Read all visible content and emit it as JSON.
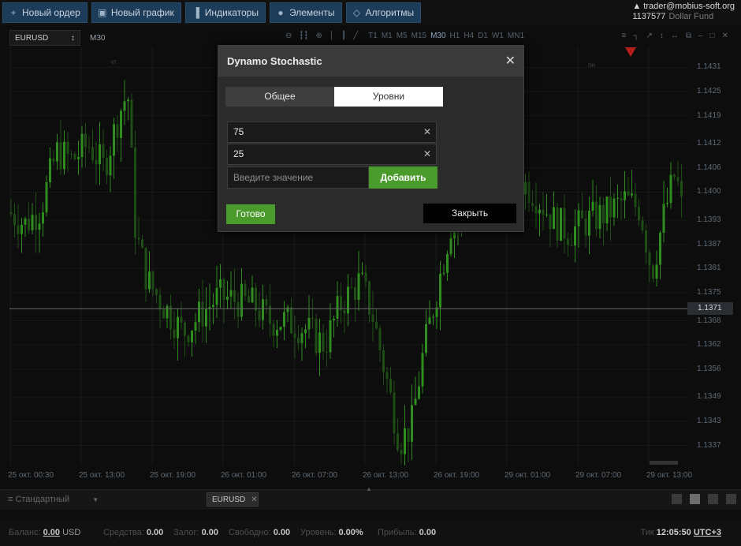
{
  "toolbar": {
    "new_order": "Новый ордер",
    "new_chart": "Новый график",
    "indicators": "Индикаторы",
    "elements": "Элементы",
    "algorithms": "Алгоритмы"
  },
  "account": {
    "email": "trader@mobius-soft.org",
    "number": "1137577",
    "fund": "Dollar Fund"
  },
  "chart_toolbar": {
    "symbol": "EURUSD",
    "timeframe": "M30",
    "timeframes": [
      "T1",
      "M1",
      "M5",
      "M15",
      "M30",
      "H1",
      "H4",
      "D1",
      "W1",
      "MN1"
    ],
    "active_timeframe": "M30"
  },
  "chart_data": {
    "type": "candlestick",
    "y_ticks": [
      "1.1431",
      "1.1425",
      "1.1419",
      "1.1412",
      "1.1406",
      "1.1400",
      "1.1393",
      "1.1387",
      "1.1381",
      "1.1375",
      "1.1368",
      "1.1362",
      "1.1356",
      "1.1349",
      "1.1343",
      "1.1337"
    ],
    "ylim": [
      1.1332,
      1.1436
    ],
    "current_price": "1.1371",
    "current_price_value": 1.1371,
    "x_ticks": [
      "25 окт. 00:30",
      "25 окт. 13:00",
      "25 окт. 19:00",
      "26 окт. 01:00",
      "26 окт. 07:00",
      "26 окт. 13:00",
      "26 окт. 19:00",
      "29 окт. 01:00",
      "29 окт. 07:00",
      "29 окт. 13:00"
    ],
    "marker_labels": [
      "чт",
      "пн"
    ],
    "up_color": "#2f8c1f",
    "down_color": "#1f4d16"
  },
  "bottom": {
    "layout_name": "Стандартный",
    "symbol_tab": "EURUSD"
  },
  "status": {
    "balance_label": "Баланс:",
    "balance_value": "0.00",
    "balance_currency": "USD",
    "funds_label": "Средства:",
    "funds_value": "0.00",
    "margin_label": "Залог:",
    "margin_value": "0.00",
    "free_label": "Свободно:",
    "free_value": "0.00",
    "level_label": "Уровень:",
    "level_value": "0.00%",
    "profit_label": "Прибыль:",
    "profit_value": "0.00",
    "tick_label": "Тик",
    "time": "12:05:50",
    "tz": "UTC+3"
  },
  "modal": {
    "title": "Dynamo Stochastic",
    "tab_general": "Общее",
    "tab_levels": "Уровни",
    "levels": [
      "75",
      "25"
    ],
    "input_placeholder": "Введите значение",
    "add_label": "Добавить",
    "done_label": "Готово",
    "close_label": "Закрыть"
  },
  "colors": {
    "accent_green": "#4a9a2c",
    "toolbar_blue": "#1d3c5a"
  }
}
